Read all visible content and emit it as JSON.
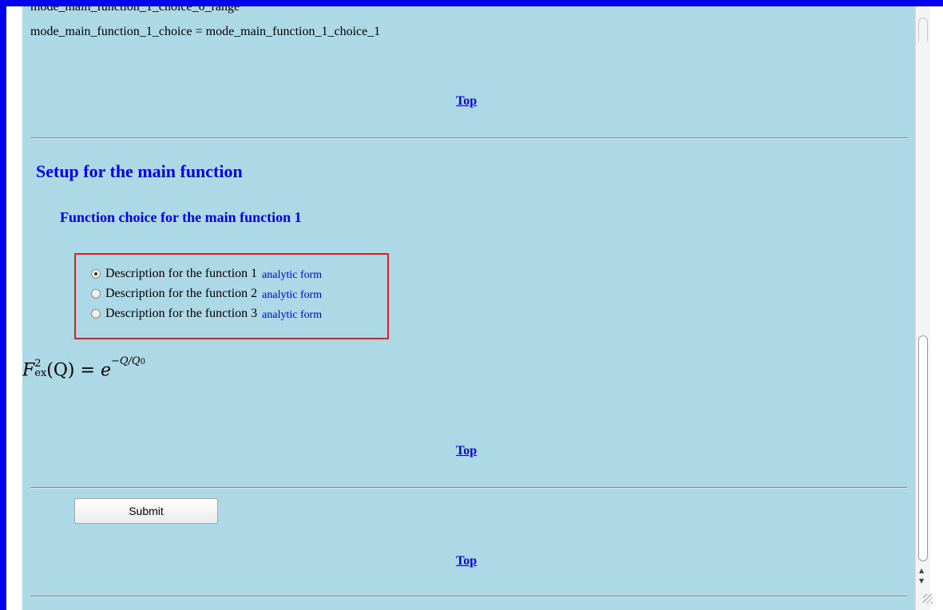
{
  "content": {
    "cutoff_line": "mode_main_function_1_choice_0_range",
    "code_line": "mode_main_function_1_choice = mode_main_function_1_choice_1",
    "top_link": "Top",
    "section_title": "Setup for the main function",
    "subsection_title": "Function choice for the main function 1",
    "choices": [
      {
        "label": "Description for the function 1",
        "link": "analytic form",
        "checked": true
      },
      {
        "label": "Description for the function 2",
        "link": "analytic form",
        "checked": false
      },
      {
        "label": "Description for the function 3",
        "link": "analytic form",
        "checked": false
      }
    ],
    "formula": {
      "lhs_letter": "F",
      "lhs_sup": "2",
      "lhs_sub": "ex",
      "lhs_arg": "(Q)",
      "equals": "=",
      "base": "e",
      "exponent": "−Q/Q",
      "exponent_sub": "0"
    },
    "submit_label": "Submit"
  },
  "colors": {
    "frame": "#0000ee",
    "page_background": "#add8e6",
    "heading": "#0000ee",
    "choice_border": "#e02020"
  },
  "scrollbar": {
    "up_arrow": "up-arrow-icon",
    "down_arrow": "down-arrow-icon"
  }
}
